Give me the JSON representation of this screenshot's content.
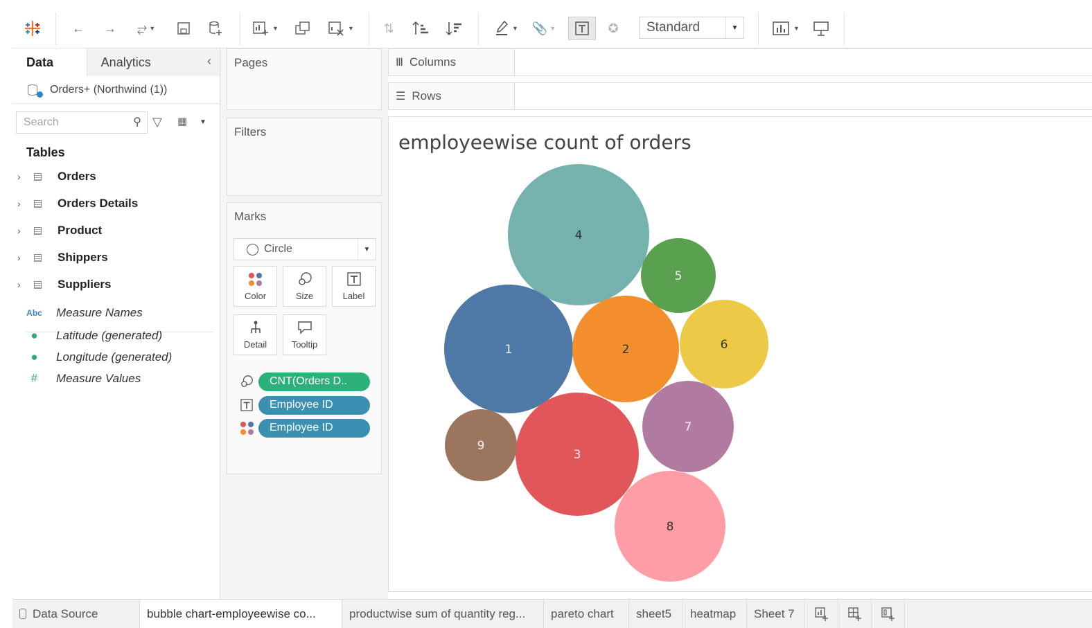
{
  "toolbar": {
    "view_mode": "Standard",
    "icons": [
      "tableau-logo-icon",
      "undo-icon",
      "redo-icon",
      "redo-dropdown-icon",
      "save-icon",
      "new-datasource-icon",
      "new-worksheet-icon",
      "duplicate-icon",
      "clear-sheet-icon",
      "swap-icon",
      "sort-ascending-icon",
      "sort-descending-icon",
      "highlight-icon",
      "group-icon",
      "show-labels-icon",
      "pin-icon",
      "fit-dropdown-icon",
      "show-me-icon",
      "presentation-icon"
    ]
  },
  "data_pane": {
    "tab_data": "Data",
    "tab_analytics": "Analytics",
    "datasource": "Orders+ (Northwind (1))",
    "search_placeholder": "Search",
    "tables_heading": "Tables",
    "tables": [
      "Orders",
      "Orders Details",
      "Product",
      "Shippers",
      "Suppliers"
    ],
    "measures": [
      {
        "label": "Measure Names",
        "icon": "Abc"
      },
      {
        "label": "Latitude (generated)",
        "icon": "globe-icon"
      },
      {
        "label": "Longitude (generated)",
        "icon": "globe-icon"
      },
      {
        "label": "Measure Values",
        "icon": "#"
      }
    ]
  },
  "shelves": {
    "pages": "Pages",
    "filters": "Filters",
    "marks": "Marks",
    "mark_type": "Circle",
    "columns": "Columns",
    "rows": "Rows",
    "buttons": {
      "color": "Color",
      "size": "Size",
      "label": "Label",
      "detail": "Detail",
      "tooltip": "Tooltip"
    },
    "pills": [
      {
        "text": "CNT(Orders D..",
        "kind": "size",
        "color": "#2bb179"
      },
      {
        "text": "Employee ID",
        "kind": "label",
        "color": "#3b8fb0"
      },
      {
        "text": "Employee ID",
        "kind": "color",
        "color": "#3b8fb0"
      }
    ]
  },
  "viz": {
    "title": "employeewise count of orders"
  },
  "chart_data": {
    "type": "bubble",
    "title": "employeewise count of orders",
    "size_field": "CNT(Orders D..",
    "label_field": "Employee ID",
    "color_field": "Employee ID",
    "series": [
      {
        "name": "4",
        "color": "#76b2ad"
      },
      {
        "name": "1",
        "color": "#4e79a7"
      },
      {
        "name": "3",
        "color": "#e15759"
      },
      {
        "name": "2",
        "color": "#f28e2b"
      },
      {
        "name": "8",
        "color": "#ff9da7"
      },
      {
        "name": "6",
        "color": "#edc948"
      },
      {
        "name": "7",
        "color": "#b07aa1"
      },
      {
        "name": "5",
        "color": "#59a14f"
      },
      {
        "name": "9",
        "color": "#9c755f"
      }
    ]
  },
  "sheet_tabs": [
    {
      "label": "Data Source",
      "active": false
    },
    {
      "label": "bubble chart-employeewise co...",
      "active": true
    },
    {
      "label": "productwise sum of quantity reg...",
      "active": false
    },
    {
      "label": "pareto chart",
      "active": false
    },
    {
      "label": "sheet5",
      "active": false
    },
    {
      "label": "heatmap",
      "active": false
    },
    {
      "label": "Sheet 7",
      "active": false
    }
  ],
  "sheet_tab_icons": [
    "new-worksheet-icon",
    "new-dashboard-icon",
    "new-story-icon"
  ]
}
